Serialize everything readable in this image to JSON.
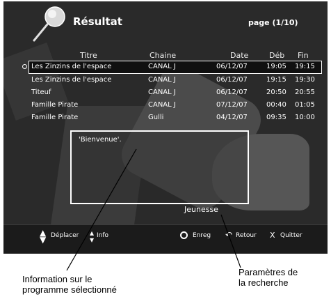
{
  "header": {
    "title": "Résultat",
    "page_indicator": "page (1/10)"
  },
  "table": {
    "columns": {
      "title": "Titre",
      "channel": "Chaine",
      "date": "Date",
      "start": "Déb",
      "end": "Fin"
    },
    "rows": [
      {
        "title": "Les Zinzins de l'espace",
        "channel": "CANAL J",
        "date": "06/12/07",
        "start": "19:05",
        "end": "19:15"
      },
      {
        "title": "Les Zinzins de l'espace",
        "channel": "CANAL J",
        "date": "06/12/07",
        "start": "19:15",
        "end": "19:30"
      },
      {
        "title": "Titeuf",
        "channel": "CANAL J",
        "date": "06/12/07",
        "start": "20:50",
        "end": "20:55"
      },
      {
        "title": "Famille Pirate",
        "channel": "CANAL J",
        "date": "07/12/07",
        "start": "00:40",
        "end": "01:05"
      },
      {
        "title": "Famille Pirate",
        "channel": "Gulli",
        "date": "04/12/07",
        "start": "09:35",
        "end": "10:00"
      }
    ]
  },
  "info": {
    "text": "'Bienvenue'."
  },
  "genre": "Jeunesse",
  "footer": {
    "move_label": "Déplacer",
    "info_label": "Info",
    "record_label": "Enreg",
    "return_label": "Retour",
    "quit_label": "Quitter",
    "quit_key": "X"
  },
  "annotations": {
    "left_line1": "Information sur le",
    "left_line2": "programme sélectionné",
    "right_line1": "Paramètres de",
    "right_line2": "la recherche"
  },
  "icons": {
    "logo": "magnifier-icon",
    "nav": "up-down-arrows-icon",
    "record": "circle-record-icon",
    "return": "return-arrow-icon",
    "quit": "x-icon"
  }
}
